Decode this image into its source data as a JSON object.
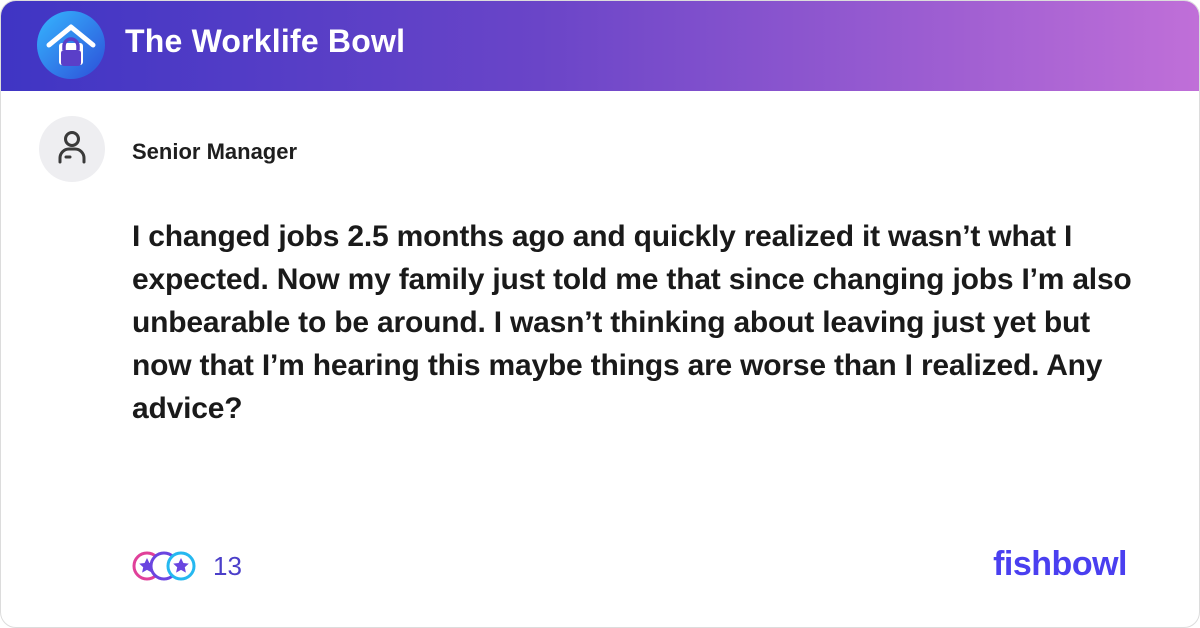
{
  "header": {
    "bowl_name": "The Worklife Bowl",
    "logo_icon": "house-lock-icon",
    "gradient_start": "#3f35c4",
    "gradient_end": "#c06fd8"
  },
  "post": {
    "author": "Senior Manager",
    "avatar_icon": "person-icon",
    "body": "I changed jobs 2.5 months ago and quickly realized it wasn’t what I expected. Now my family just told me that since changing jobs I’m also unbearable to be around. I wasn’t thinking about leaving just yet but now that I’m hearing this maybe things are worse than I realized. Any advice?"
  },
  "reactions": {
    "count": "13",
    "icons": [
      "star-reaction-icon",
      "moon-reaction-icon",
      "star-reaction-icon"
    ]
  },
  "brand": {
    "name": "fishbowl",
    "color": "#4a3ff0"
  }
}
